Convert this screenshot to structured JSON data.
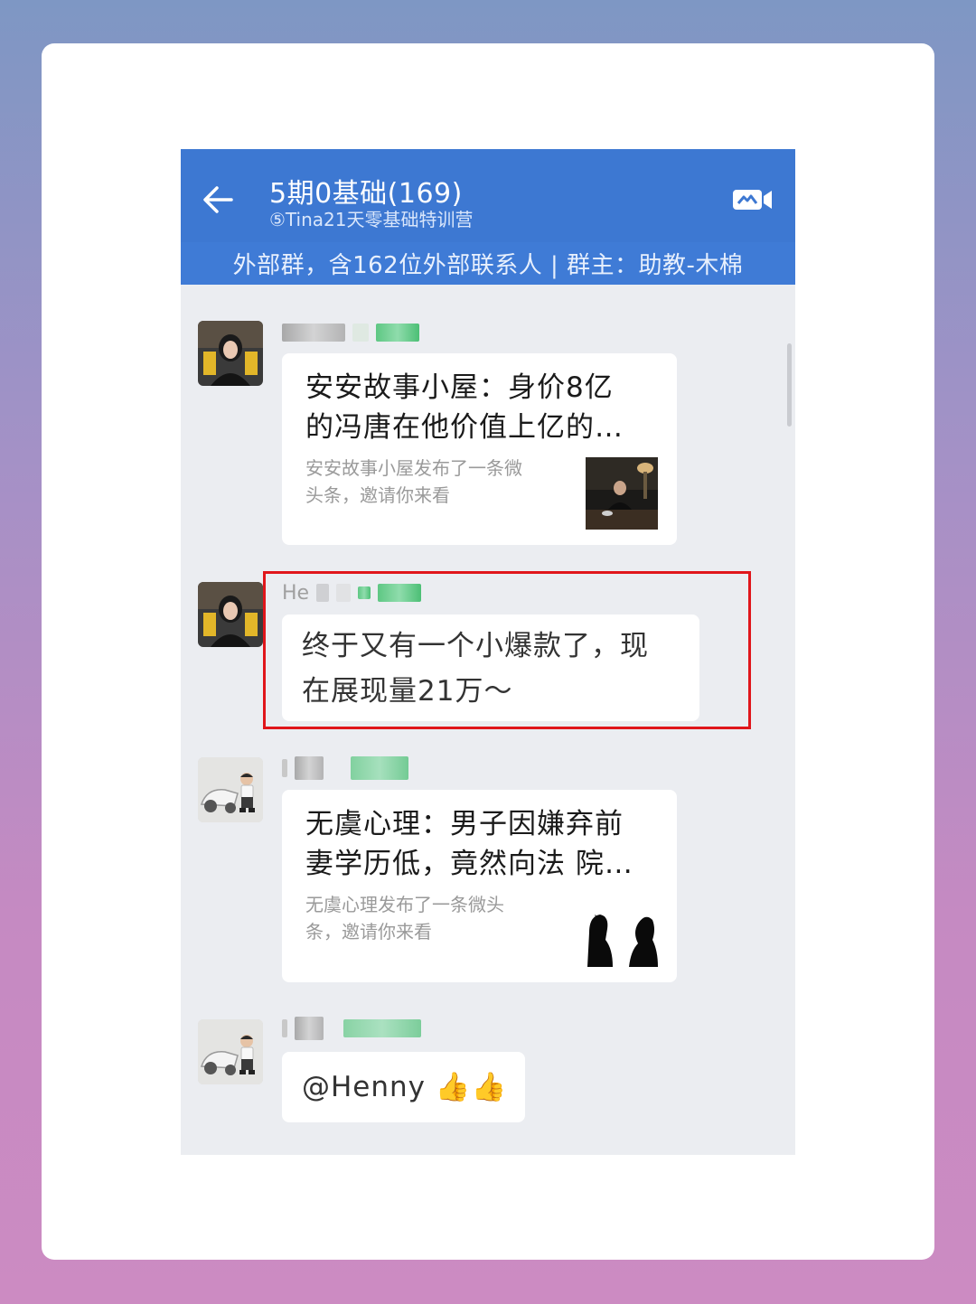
{
  "header": {
    "title": "5期0基础(169)",
    "subtitle": "⑤Tina21天零基础特训营",
    "info": "外部群，含162位外部联系人 | 群主：助教-木棉"
  },
  "messages": [
    {
      "sender_visible": "",
      "type": "link-card",
      "title_line1": "安安故事小屋：身价8亿",
      "title_line2": "的冯唐在他价值上亿的…",
      "desc_line1": "安安故事小屋发布了一条微",
      "desc_line2": "头条，邀请你来看"
    },
    {
      "sender_visible": "He",
      "type": "text",
      "line1": "终于又有一个小爆款了，现",
      "line2": "在展现量21万～"
    },
    {
      "sender_visible": "",
      "type": "link-card",
      "title_line1": "无虞心理：男子因嫌弃前",
      "title_line2": "妻学历低，竟然向法 院…",
      "desc_line1": "无虞心理发布了一条微头",
      "desc_line2": "条，邀请你来看"
    },
    {
      "sender_visible": "",
      "type": "text",
      "text": "@Henny 👍👍"
    }
  ],
  "colors": {
    "topbar": "#3d78d2",
    "highlight": "#e0161b",
    "chat_bg": "#ebedf1"
  },
  "icons": {
    "back": "back-arrow-icon",
    "video": "video-call-icon",
    "thumbs": "thumbs-up-emoji"
  }
}
